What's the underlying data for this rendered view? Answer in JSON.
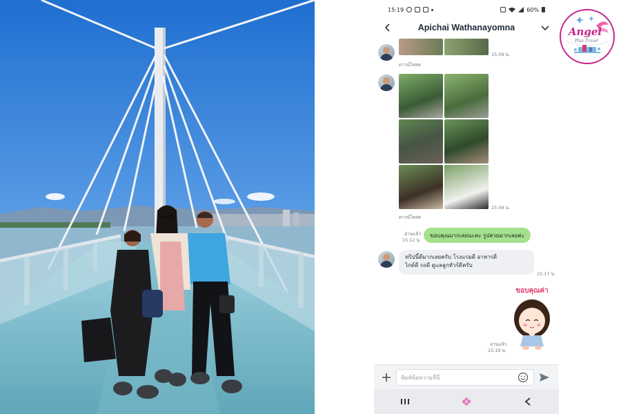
{
  "status_bar": {
    "time": "15:19",
    "battery": "60%"
  },
  "chat": {
    "title": "Apichai Wathanayomna",
    "messages": {
      "time_1": "15.09 น.",
      "sender_1": "ดาวน์โหลด",
      "time_2": "15.09 น.",
      "sender_2": "ดาวน์โหลด",
      "outgoing_text": "ขอบคุณมากเลยนะคะ รูปสวยมากเลยค่ะ",
      "read_1": "อ่านแล้ว",
      "time_3": "15.12 น.",
      "incoming_line1": "ทริปนี้ดีมากเลยครับ โรงแรมดี อาหารดี",
      "incoming_line2": "ไกด์ดี รถดี  ดูแลลูกทัวร์ดีครับ",
      "time_4": "15.17 น.",
      "sticker_text": "ขอบคุณค่า",
      "read_2": "อ่านแล้ว",
      "time_5": "15.19 น."
    },
    "input_placeholder": "พิมพ์ข้อความที่นี่"
  },
  "logo": {
    "line1": "Angel",
    "line2": "Plus Travel"
  },
  "colors": {
    "outgoing_bubble": "#a5e08d",
    "incoming_bubble": "#eef0f3",
    "sky": "#3b7fd6",
    "logo_accent": "#c4248a"
  },
  "icons": [
    "back-icon",
    "chevron-down-icon",
    "plus-icon",
    "emoji-icon",
    "send-icon",
    "recent-apps-icon",
    "home-icon",
    "nav-back-icon"
  ]
}
